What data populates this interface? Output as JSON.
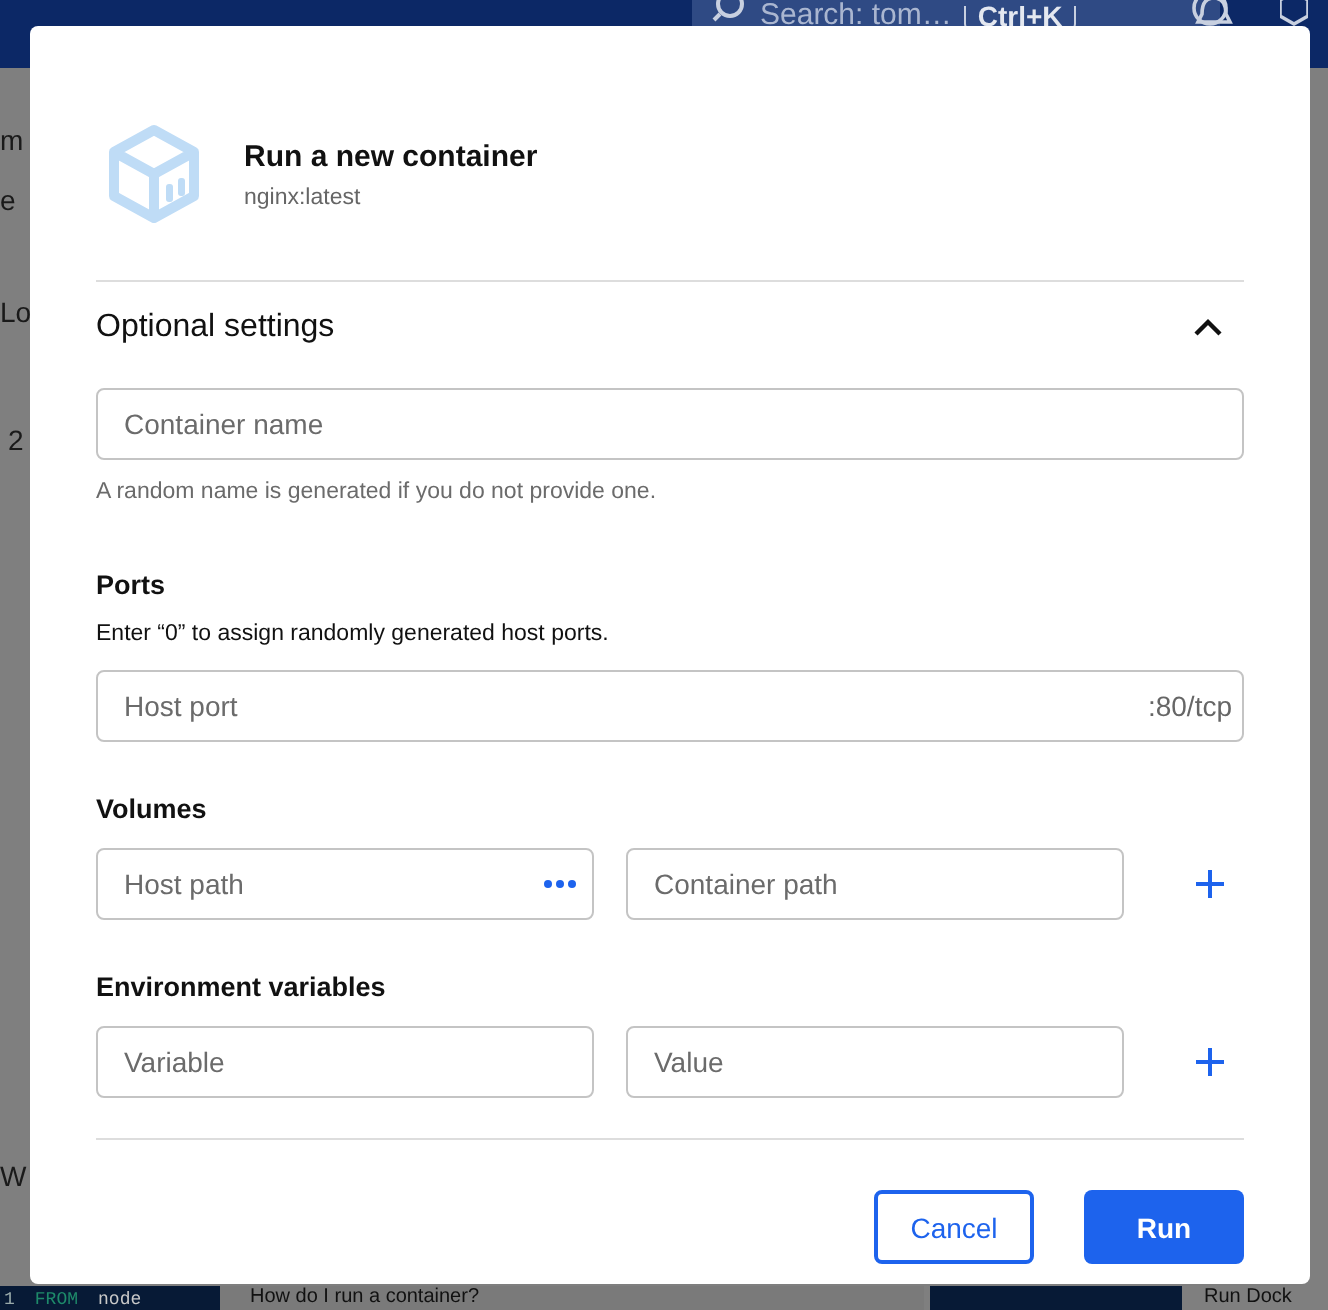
{
  "background": {
    "search": {
      "placeholder": "Search: tom…",
      "shortcut": "Ctrl+K"
    },
    "fragments": [
      "m",
      "e",
      "Lo",
      "2",
      "W"
    ],
    "code": {
      "line_number": "1",
      "keyword": "FROM",
      "text": "node"
    },
    "cards": [
      "How do I run a container?",
      "Run Dock"
    ]
  },
  "dialog": {
    "title": "Run a new container",
    "subtitle": "nginx:latest",
    "section": {
      "title": "Optional settings",
      "expanded": true
    },
    "name_field": {
      "placeholder": "Container name",
      "help": "A random name is generated if you do not provide one."
    },
    "groups": [
      {
        "title": "Ports",
        "note": "Enter “0” to assign randomly generated host ports.",
        "rows": [
          {
            "fields": [
              {
                "placeholder": "Host port",
                "suffix": ":80/tcp",
                "browse": false
              }
            ],
            "addable": false
          }
        ]
      },
      {
        "title": "Volumes",
        "rows": [
          {
            "fields": [
              {
                "placeholder": "Host path",
                "browse": true
              },
              {
                "placeholder": "Container path",
                "browse": false
              }
            ],
            "addable": true
          }
        ]
      },
      {
        "title": "Environment variables",
        "rows": [
          {
            "fields": [
              {
                "placeholder": "Variable",
                "browse": false
              },
              {
                "placeholder": "Value",
                "browse": false
              }
            ],
            "addable": true
          }
        ]
      }
    ],
    "buttons": [
      {
        "label": "Cancel",
        "kind": "secondary"
      },
      {
        "label": "Run",
        "kind": "primary"
      }
    ]
  }
}
